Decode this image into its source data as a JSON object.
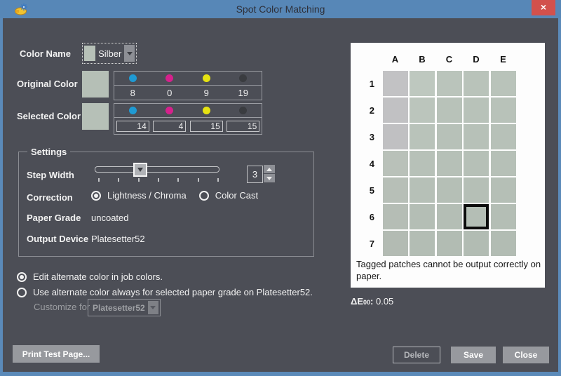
{
  "window": {
    "title": "Spot Color Matching",
    "close_glyph": "×"
  },
  "color_name": {
    "label": "Color Name",
    "value": "Silber",
    "swatch_color": "#b7c1b8"
  },
  "original_color": {
    "label": "Original Color",
    "swatch_color": "#b5bfb6",
    "channels": [
      {
        "name": "cyan",
        "color": "#1f9ad3",
        "value": "8"
      },
      {
        "name": "magenta",
        "color": "#d6218c",
        "value": "0"
      },
      {
        "name": "yellow",
        "color": "#e6e312",
        "value": "9"
      },
      {
        "name": "black",
        "color": "#3a3c40",
        "value": "19"
      }
    ]
  },
  "selected_color": {
    "label": "Selected Color",
    "swatch_color": "#b6c0b7",
    "channels": [
      {
        "name": "cyan",
        "color": "#1f9ad3",
        "value": "14"
      },
      {
        "name": "magenta",
        "color": "#d6218c",
        "value": "4"
      },
      {
        "name": "yellow",
        "color": "#e6e312",
        "value": "15"
      },
      {
        "name": "black",
        "color": "#3a3c40",
        "value": "15"
      }
    ]
  },
  "settings": {
    "title": "Settings",
    "step_width": {
      "label": "Step Width",
      "value": "3",
      "tick_count": 7
    },
    "correction": {
      "label": "Correction",
      "options": [
        {
          "label": "Lightness / Chroma",
          "selected": true
        },
        {
          "label": "Color Cast",
          "selected": false
        }
      ]
    },
    "paper_grade": {
      "label": "Paper Grade",
      "value": "uncoated"
    },
    "output_device": {
      "label": "Output Device",
      "value": "Platesetter52"
    }
  },
  "alternate": {
    "options": [
      {
        "label": "Edit alternate color in job colors.",
        "selected": true
      },
      {
        "label": "Use alternate color always for selected paper grade on Platesetter52.",
        "selected": false
      }
    ]
  },
  "customize": {
    "label": "Customize for",
    "value": "Platesetter52",
    "disabled": true
  },
  "patch_grid": {
    "columns": [
      "A",
      "B",
      "C",
      "D",
      "E"
    ],
    "rows": [
      "1",
      "2",
      "3",
      "4",
      "5",
      "6",
      "7"
    ],
    "selected": {
      "row_index": 5,
      "col_index": 3
    },
    "note": "Tagged patches cannot be output correctly on paper.",
    "cell_colors": [
      [
        "#c2c2c4",
        "#bec8bf",
        "#bac4bb",
        "#b9c3ba",
        "#b9c3ba"
      ],
      [
        "#c1c1c3",
        "#bbc5bc",
        "#b8c2b9",
        "#b8c2b9",
        "#b8c2b9"
      ],
      [
        "#c0c0c2",
        "#b9c3ba",
        "#b7c1b8",
        "#b7c1b8",
        "#b7c1b8"
      ],
      [
        "#b9c1b9",
        "#b7c1b8",
        "#b6c0b7",
        "#b6c0b7",
        "#b6c0b7"
      ],
      [
        "#b7bfb7",
        "#b6c0b7",
        "#b5bfb6",
        "#b5bfb6",
        "#b5bfb6"
      ],
      [
        "#b5bdb5",
        "#b4beb5",
        "#b4beb5",
        "#b4beb5",
        "#b4beb5"
      ],
      [
        "#b3bbb3",
        "#b3bdb4",
        "#b2bcb3",
        "#b2bcb3",
        "#b2bcb3"
      ]
    ]
  },
  "delta_e": {
    "symbol": "ΔE",
    "subscript": "00",
    "separator": ": ",
    "value": "0.05"
  },
  "buttons": {
    "print_test_page": "Print Test Page...",
    "delete": "Delete",
    "save": "Save",
    "close": "Close"
  },
  "colors": {
    "titlebar_blue": "#5787b7",
    "window_border_blue": "#5b8ab9",
    "dialog_bg": "#4c4e56",
    "panel_white": "#fdfdfd",
    "button_gray": "#97999e",
    "close_red": "#d2514d"
  }
}
